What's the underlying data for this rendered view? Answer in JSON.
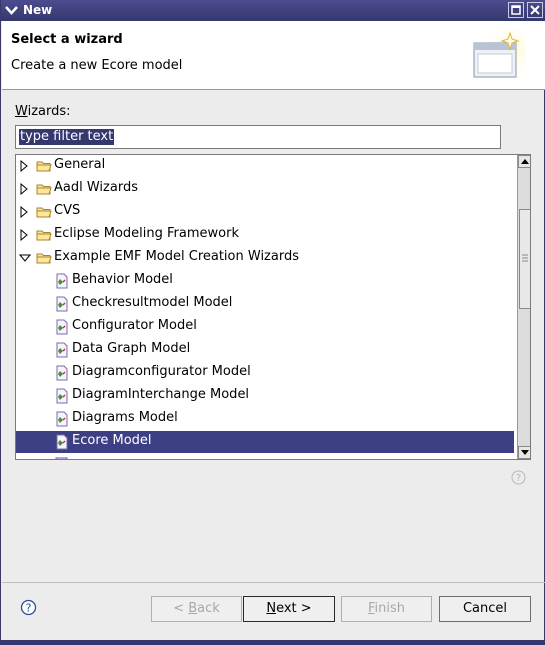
{
  "window": {
    "title": "New"
  },
  "banner": {
    "heading": "Select a wizard",
    "subtitle": "Create a new Ecore model"
  },
  "wizards_label": {
    "mnemonic": "W",
    "rest": "izards:"
  },
  "filter": {
    "value": "type filter text"
  },
  "tree": {
    "items": [
      {
        "label": "General",
        "type": "folder",
        "expanded": false
      },
      {
        "label": "Aadl Wizards",
        "type": "folder",
        "expanded": false
      },
      {
        "label": "CVS",
        "type": "folder",
        "expanded": false
      },
      {
        "label": "Eclipse Modeling Framework",
        "type": "folder",
        "expanded": false
      },
      {
        "label": "Example EMF Model Creation Wizards",
        "type": "folder",
        "expanded": true
      },
      {
        "label": "Behavior Model",
        "type": "model"
      },
      {
        "label": "Checkresultmodel Model",
        "type": "model"
      },
      {
        "label": "Configurator Model",
        "type": "model"
      },
      {
        "label": "Data Graph Model",
        "type": "model"
      },
      {
        "label": "Diagramconfigurator Model",
        "type": "model"
      },
      {
        "label": "DiagramInterchange Model",
        "type": "model"
      },
      {
        "label": "Diagrams Model",
        "type": "model"
      },
      {
        "label": "Ecore Model",
        "type": "model",
        "selected": true
      }
    ]
  },
  "buttons": {
    "back": {
      "mnemonic": "B",
      "pre": "< ",
      "rest": "ack",
      "enabled": false
    },
    "next": {
      "mnemonic": "N",
      "rest": "ext >",
      "enabled": true
    },
    "finish": {
      "mnemonic": "F",
      "rest": "inish",
      "enabled": false
    },
    "cancel": {
      "label": "Cancel",
      "enabled": true
    }
  },
  "colors": {
    "selection": "#3d3f84",
    "titlebar": "#35376f"
  }
}
